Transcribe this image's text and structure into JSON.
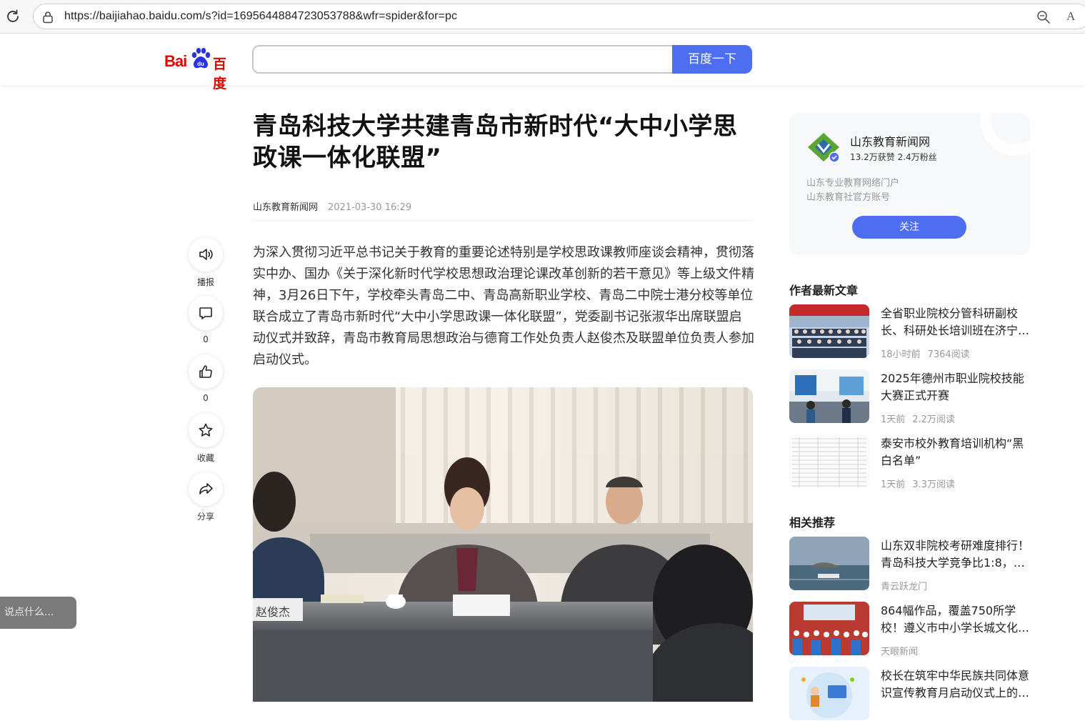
{
  "browser": {
    "url": "https://baijiahao.baidu.com/s?id=1695644884723053788&wfr=spider&for=pc",
    "read_aloud_glyph": "A"
  },
  "header": {
    "logo_latin": "Bai",
    "logo_cn": "百度",
    "search_placeholder": "",
    "search_button": "百度一下"
  },
  "article": {
    "title": "青岛科技大学共建青岛市新时代“大中小学思政课一体化联盟”",
    "source": "山东教育新闻网",
    "date": "2021-03-30 16:29",
    "paragraph": "为深入贯彻习近平总书记关于教育的重要论述特别是学校思政课教师座谈会精神，贯彻落实中办、国办《关于深化新时代学校思想政治理论课改革创新的若干意见》等上级文件精神，3月26日下午，学校牵头青岛二中、青岛高新职业学校、青岛二中院士港分校等单位联合成立了青岛市新时代“大中小学思政课一体化联盟”，党委副书记张淑华出席联盟启动仪式并致辞，青岛市教育局思想政治与德育工作处负责人赵俊杰及联盟单位负责人参加启动仪式。",
    "photo_nameplate": "赵俊杰"
  },
  "rail": {
    "listen_label": "播报",
    "comment_count": "0",
    "like_count": "0",
    "collect_label": "收藏",
    "share_label": "分享"
  },
  "comment_input": {
    "placeholder": "说点什么..."
  },
  "author": {
    "name": "山东教育新闻网",
    "stats": "13.2万获赞 2.4万粉丝",
    "desc_line1": "山东专业教育网络门户",
    "desc_line2": "山东教育社官方账号",
    "follow_label": "关注",
    "badge_color": "#4e6ef2"
  },
  "latest": {
    "title": "作者最新文章",
    "items": [
      {
        "title": "全省职业院校分管科研副校长、科研处长培训班在济宁…",
        "time": "18小时前",
        "reads": "7364阅读"
      },
      {
        "title": "2025年德州市职业院校技能大赛正式开赛",
        "time": "1天前",
        "reads": "2.2万阅读"
      },
      {
        "title": "泰安市校外教育培训机构“黑白名单”",
        "time": "1天前",
        "reads": "3.3万阅读"
      }
    ]
  },
  "related": {
    "title": "相关推荐",
    "items": [
      {
        "title": "山东双非院校考研难度排行！青岛科技大学竞争比1:8，…",
        "source": "青云跃龙门"
      },
      {
        "title": "864幅作品，覆盖750所学校！遵义市中小学长城文化…",
        "source": "天眼新闻"
      },
      {
        "title": "校长在筑牢中华民族共同体意识宣传教育月启动仪式上的…",
        "source": ""
      }
    ]
  },
  "colors": {
    "accent": "#4e6ef2",
    "brand_red": "#e10602"
  }
}
